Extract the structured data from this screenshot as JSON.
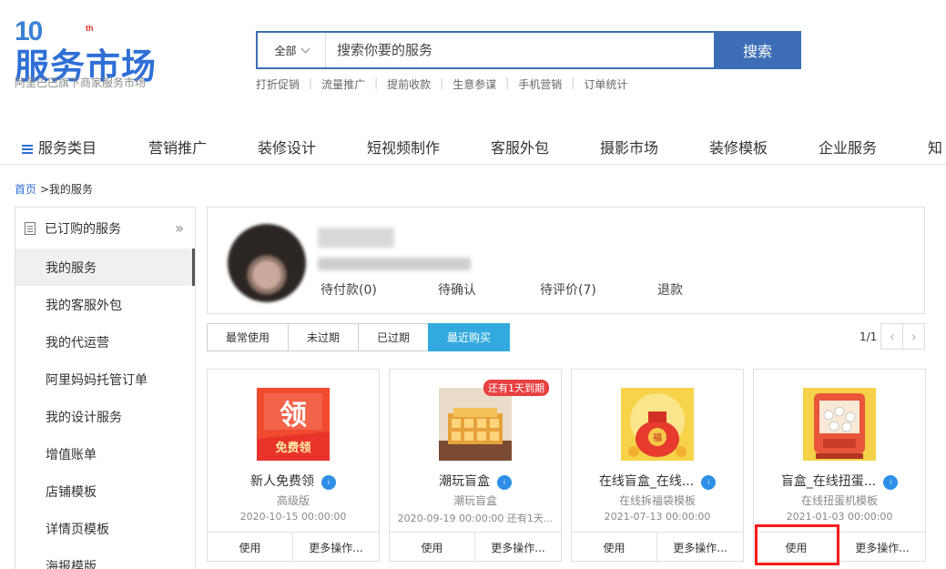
{
  "header": {
    "logo_number": "10",
    "logo_sup": "th",
    "logo_title": "服务市场",
    "logo_subtitle": "阿里巴巴旗下商家服务市场",
    "search_category": "全部",
    "search_placeholder": "搜索你要的服务",
    "search_button": "搜索",
    "hot_links": [
      "打折促销",
      "流量推广",
      "提前收款",
      "生意参谋",
      "手机营销",
      "订单统计"
    ]
  },
  "nav": {
    "items": [
      "服务类目",
      "营销推广",
      "装修设计",
      "短视频制作",
      "客服外包",
      "摄影市场",
      "装修模板",
      "企业服务",
      "知"
    ]
  },
  "breadcrumb": {
    "home": "首页",
    "current": ">我的服务"
  },
  "sidebar": {
    "header": "已订购的服务",
    "collapse_icon": "»",
    "items": [
      "我的服务",
      "我的客服外包",
      "我的代运营",
      "阿里妈妈托管订单",
      "我的设计服务",
      "增值账单",
      "店铺模板",
      "详情页模板",
      "海报模版"
    ],
    "active_index": 0
  },
  "profile": {
    "order_stats": [
      "待付款(0)",
      "待确认",
      "待评价(7)",
      "退款"
    ]
  },
  "filters": {
    "tabs": [
      "最常使用",
      "未过期",
      "已过期",
      "最近购买"
    ],
    "active_tab": "最近购买",
    "pager": "1/1"
  },
  "cards": [
    {
      "title": "新人免费领",
      "verify": "i",
      "subtitle": "高级版",
      "date": "2020-10-15 00:00:00",
      "use": "使用",
      "more": "更多操作...",
      "badge": "",
      "thumb_icon": "free-coupon-icon"
    },
    {
      "title": "潮玩盲盒",
      "verify": "i",
      "subtitle": "潮玩盲盒",
      "date": "2020-09-19 00:00:00 还有1天...",
      "use": "使用",
      "more": "更多操作...",
      "badge": "还有1天到期",
      "thumb_icon": "blind-box-icon"
    },
    {
      "title": "在线盲盒_在线...",
      "verify": "i",
      "subtitle": "在线拆福袋模板",
      "date": "2021-07-13 00:00:00",
      "use": "使用",
      "more": "更多操作...",
      "badge": "",
      "thumb_icon": "lucky-bag-icon"
    },
    {
      "title": "盲盒_在线扭蛋...",
      "verify": "i",
      "subtitle": "在线扭蛋机模板",
      "date": "2021-01-03 00:00:00",
      "use": "使用",
      "more": "更多操作...",
      "badge": "",
      "thumb_icon": "capsule-machine-icon"
    }
  ],
  "colors": {
    "brand_blue": "#3d6eb5",
    "tab_active": "#33aadf",
    "badge_red": "#e84040",
    "highlight": "#ff1a1a"
  }
}
